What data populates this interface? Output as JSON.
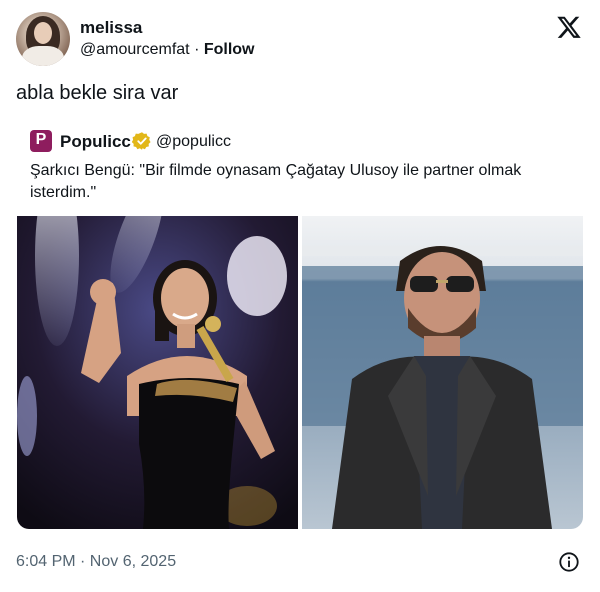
{
  "author": {
    "name": "melissa",
    "handle": "@amourcemfat",
    "separator": "·",
    "follow_label": "Follow",
    "avatar_icon": "profile-photo"
  },
  "platform_icon": "x-logo-icon",
  "tweet": {
    "text": "abla bekle sira var"
  },
  "quoted": {
    "name": "Populicc",
    "handle": "@populicc",
    "logo_letter": "P",
    "logo_color": "#8e1d5e",
    "verified_color": "#e2b719",
    "text": "Şarkıcı Bengü: \"Bir filmde oynasam Çağatay Ulusoy ile partner olmak isterdim.\"",
    "images": [
      {
        "name": "singer-on-stage-photo"
      },
      {
        "name": "man-in-sunglasses-suit-photo"
      }
    ]
  },
  "footer": {
    "timestamp": "6:04 PM · Nov 6, 2025",
    "info_icon": "info-icon"
  }
}
